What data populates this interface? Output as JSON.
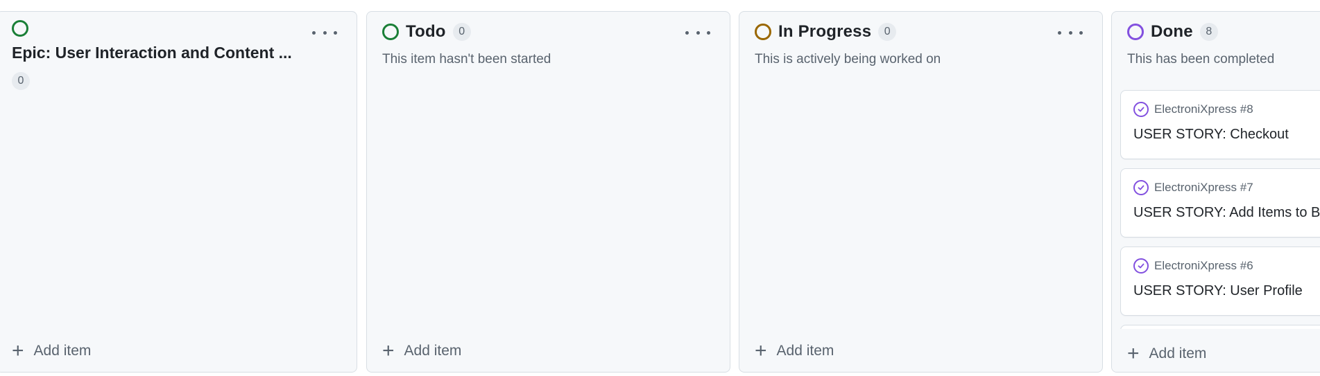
{
  "columns": {
    "epic": {
      "title": "Epic: User Interaction and Content ...",
      "count": "0",
      "add_label": "Add item",
      "status_color": "#1a7f37"
    },
    "todo": {
      "title": "Todo",
      "count": "0",
      "description": "This item hasn't been started",
      "add_label": "Add item",
      "status_color": "#1a7f37"
    },
    "in_progress": {
      "title": "In Progress",
      "count": "0",
      "description": "This is actively being worked on",
      "add_label": "Add item",
      "status_color": "#9a6700"
    },
    "done": {
      "title": "Done",
      "count": "8",
      "description": "This has been completed",
      "add_label": "Add item",
      "status_color": "#8250df",
      "cards": [
        {
          "ref": "ElectroniXpress #8",
          "title": "USER STORY: Checkout"
        },
        {
          "ref": "ElectroniXpress #7",
          "title": "USER STORY: Add Items to Ba"
        },
        {
          "ref": "ElectroniXpress #6",
          "title": "USER STORY: User Profile"
        }
      ]
    }
  },
  "icons": {
    "more": "kebab-horizontal-icon",
    "add": "plus-icon",
    "status": "circle-icon",
    "done": "check-circle-icon"
  }
}
